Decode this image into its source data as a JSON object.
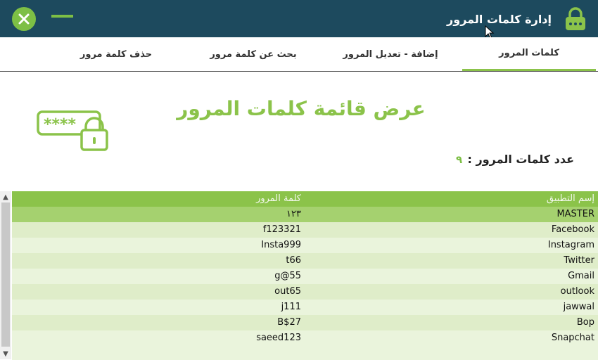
{
  "window": {
    "title": "إدارة كلمات المرور",
    "colors": {
      "titlebar": "#1d4a5e",
      "accent": "#8bc34a"
    }
  },
  "tabs": [
    {
      "label": "كلمات المرور",
      "active": true
    },
    {
      "label": "إضافة - تعديل المرور",
      "active": false
    },
    {
      "label": "بحث عن كلمة مرور",
      "active": false
    },
    {
      "label": "حذف كلمة مرور",
      "active": false
    }
  ],
  "main": {
    "heading": "عرض قائمة كلمات المرور",
    "count_label": "عدد كلمات المرور :",
    "count_value": "٩"
  },
  "table": {
    "columns": [
      "إسم التطبيق",
      "كلمة المرور"
    ],
    "rows": [
      {
        "app": "MASTER",
        "password": "١٢٣"
      },
      {
        "app": "Facebook",
        "password": "f123321"
      },
      {
        "app": "Instagram",
        "password": "Insta999"
      },
      {
        "app": "Twitter",
        "password": "t66"
      },
      {
        "app": "Gmail",
        "password": "g@55"
      },
      {
        "app": "outlook",
        "password": "out65"
      },
      {
        "app": "jawwal",
        "password": "j111"
      },
      {
        "app": "Bop",
        "password": "B$27"
      },
      {
        "app": "Snapchat",
        "password": "saeed123"
      }
    ]
  },
  "icons": {
    "close": "close-icon",
    "minimize": "minimize-icon",
    "lock": "lock-icon",
    "password_field": "password-lock-icon"
  }
}
